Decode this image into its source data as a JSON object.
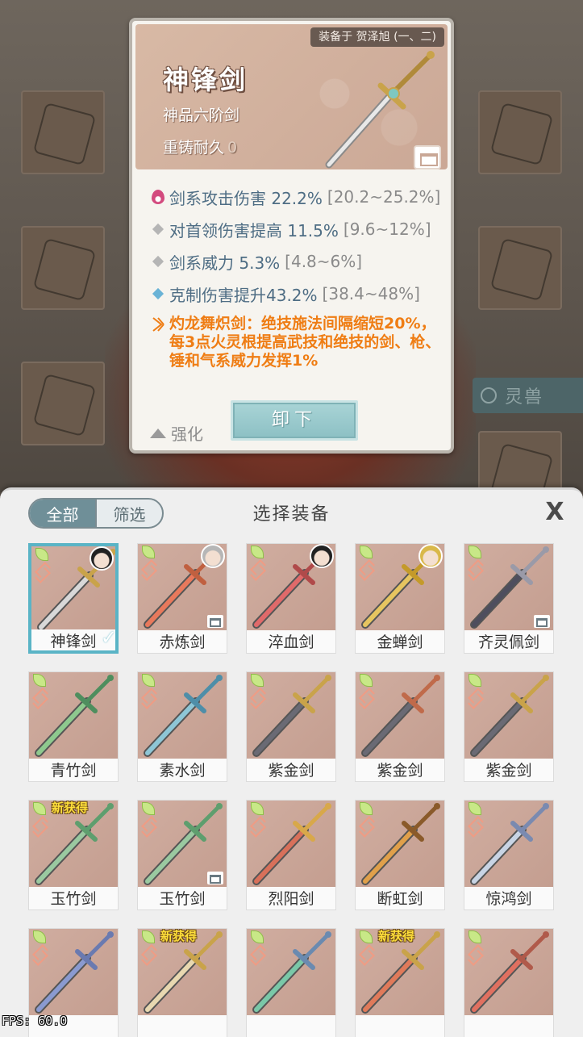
{
  "detail": {
    "equipped_on": "装备于 贺泽旭 (一、二)",
    "name": "神锋剑",
    "grade": "神品六阶剑",
    "reforge_label": "重铸耐久",
    "reforge_value": "0",
    "stats": [
      {
        "icon": "flame-icon",
        "text": "剑系攻击伤害 22.2%",
        "range": "[20.2~25.2%]"
      },
      {
        "icon": "gray-diamond-icon",
        "text": "对首领伤害提高 11.5%",
        "range": "[9.6~12%]"
      },
      {
        "icon": "gray-diamond-icon",
        "text": "剑系威力 5.3%",
        "range": "[4.8~6%]"
      },
      {
        "icon": "blue-diamond-icon",
        "text": "克制伤害提升43.2%",
        "range": "[38.4~48%]"
      }
    ],
    "special": "灼龙舞炽剑：绝技施法间隔缩短20%，每3点火灵根提高武技和绝技的剑、枪、锤和气系威力发挥1%",
    "strengthen_label": "强化",
    "unequip_label": "卸下"
  },
  "background": {
    "spirit_label": "灵兽"
  },
  "panel": {
    "filter_all": "全部",
    "filter_screen": "筛选",
    "title": "选择装备",
    "close": "X"
  },
  "items": [
    {
      "name": "神锋剑",
      "blade": "#d8d8d8",
      "hilt": "#c9a34a",
      "avatar": "dark",
      "selected": true,
      "chest": false,
      "new": false
    },
    {
      "name": "赤炼剑",
      "blade": "#e8795c",
      "hilt": "#c06040",
      "avatar": "silver",
      "selected": false,
      "chest": true,
      "new": false
    },
    {
      "name": "淬血剑",
      "blade": "#e06a6a",
      "hilt": "#b04a4a",
      "avatar": "dark",
      "selected": false,
      "chest": false,
      "new": false
    },
    {
      "name": "金蝉剑",
      "blade": "#e6c560",
      "hilt": "#c49a2a",
      "avatar": "blond",
      "selected": false,
      "chest": false,
      "new": false
    },
    {
      "name": "齐灵佩剑",
      "blade": "#4e4e5e",
      "hilt": "#9a9aa8",
      "avatar": "",
      "selected": false,
      "chest": true,
      "new": false
    },
    {
      "name": "青竹剑",
      "blade": "#8ec98e",
      "hilt": "#4e8e5e",
      "avatar": "",
      "selected": false,
      "chest": false,
      "new": false
    },
    {
      "name": "素水剑",
      "blade": "#8ec6d6",
      "hilt": "#4e8ea8",
      "avatar": "",
      "selected": false,
      "chest": false,
      "new": false
    },
    {
      "name": "紫金剑",
      "blade": "#6a6a74",
      "hilt": "#c9a34a",
      "avatar": "",
      "selected": false,
      "chest": false,
      "new": false
    },
    {
      "name": "紫金剑",
      "blade": "#6a6a74",
      "hilt": "#c06a4a",
      "avatar": "",
      "selected": false,
      "chest": false,
      "new": false
    },
    {
      "name": "紫金剑",
      "blade": "#6a6a74",
      "hilt": "#c9a34a",
      "avatar": "",
      "selected": false,
      "chest": false,
      "new": false
    },
    {
      "name": "玉竹剑",
      "blade": "#9ac9a0",
      "hilt": "#5e9e6e",
      "avatar": "",
      "selected": false,
      "chest": false,
      "new": true
    },
    {
      "name": "玉竹剑",
      "blade": "#9ac9a0",
      "hilt": "#5e9e6e",
      "avatar": "",
      "selected": false,
      "chest": true,
      "new": false
    },
    {
      "name": "烈阳剑",
      "blade": "#d8705a",
      "hilt": "#d8a84a",
      "avatar": "",
      "selected": false,
      "chest": false,
      "new": false
    },
    {
      "name": "断虹剑",
      "blade": "#e0a04a",
      "hilt": "#8a5a2a",
      "avatar": "",
      "selected": false,
      "chest": false,
      "new": false
    },
    {
      "name": "惊鸿剑",
      "blade": "#c8d4e4",
      "hilt": "#7a8ab0",
      "avatar": "",
      "selected": false,
      "chest": false,
      "new": false
    },
    {
      "name": "",
      "blade": "#8a9ad0",
      "hilt": "#6a7ab0",
      "avatar": "",
      "selected": false,
      "chest": false,
      "new": false
    },
    {
      "name": "",
      "blade": "#e8d8b0",
      "hilt": "#c9a34a",
      "avatar": "",
      "selected": false,
      "chest": false,
      "new": true
    },
    {
      "name": "",
      "blade": "#7ac8a8",
      "hilt": "#6a8ab0",
      "avatar": "",
      "selected": false,
      "chest": false,
      "new": false
    },
    {
      "name": "",
      "blade": "#e07a5a",
      "hilt": "#c9a34a",
      "avatar": "",
      "selected": false,
      "chest": false,
      "new": true
    },
    {
      "name": "",
      "blade": "#e07060",
      "hilt": "#b05a4a",
      "avatar": "",
      "selected": false,
      "chest": false,
      "new": false
    }
  ],
  "labels": {
    "new_tag": "新获得"
  },
  "fps": "FPS: 60.0"
}
